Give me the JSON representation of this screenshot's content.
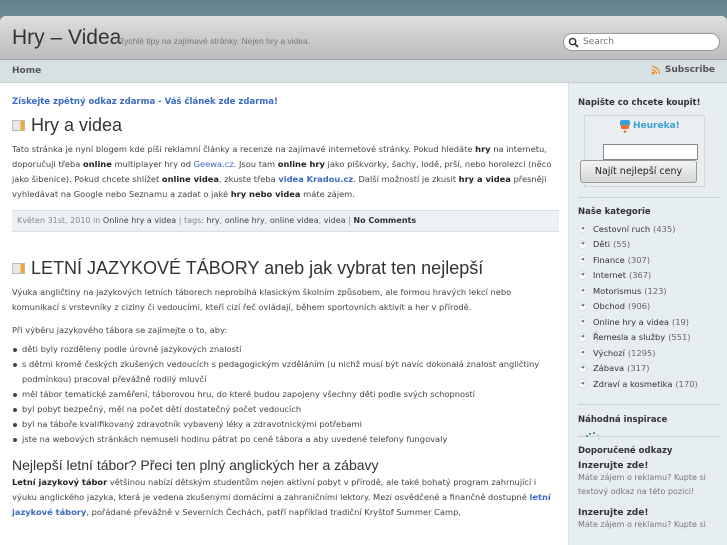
{
  "header": {
    "site_title": "Hry – Videa",
    "tagline": "Rychlé tipy na zajímavé stránky. Nejen hry a videa.",
    "search_placeholder": "Search"
  },
  "nav": {
    "home": "Home",
    "subscribe": "Subscribe"
  },
  "promo_link": "Získejte zpětný odkaz zdarma - Váš článek zde zdarma!",
  "post1": {
    "title": "Hry a videa",
    "p1": "Tato stránka je nyní blogem kde píši reklamní články a recenze na zajímavé internetové stránky. Pokud hledáte ",
    "b_hry": "hry",
    "p2": " na internetu, doporučuji třeba ",
    "b_online": "online",
    "p3": " multiplayer hry od ",
    "link_geewa": "Geewa.cz",
    "p4": ". Jsou tam ",
    "b_online_hry": "online hry",
    "p5": " jako piškvorky, šachy, lodě, prší, nebo horolezci (něco jako šibenice). Pokud chcete shlížet ",
    "b_online_videa": "online videa",
    "p6": ", zkuste třeba ",
    "link_kradou": "videa Kradou.cz",
    "p7": ". Další možností je zkusit ",
    "b_hry_a_videa": "hry a videa",
    "p8": " přesněji vyhledávat na Google nebo Seznamu a zadat o jaké ",
    "b_hry_nebo_videa": "hry nebo videa",
    "p9": " máte zájem.",
    "meta": {
      "date": "Květen 31st, 2010 in ",
      "category": "Online hry a videa",
      "tags_label": " | tags: ",
      "tags": [
        "hry",
        "online hry",
        "online videa",
        "videa"
      ],
      "comments": "No Comments"
    }
  },
  "post2": {
    "title": "LETNÍ JAZYKOVÉ TÁBORY aneb jak vybrat ten nejlepší",
    "intro": "Výuka angličtiny na jazykových letních táborech neprobíhá klasickým školním způsobem, ale formou hravých lekcí nebo komunikací s vrstevníky z ciziny či vedoucími, kteří cizí řeč ovládají, během sportovních aktivit a her v přírodě.",
    "lead": "Při výběru jazykového tábora se zajímejte o to, aby:",
    "bullets": [
      "děti byly rozděleny podle úrovně jazykových znalostí",
      "s dětmi kromě českých zkušených vedoucích s pedagogickým vzděláním (u nichž musí být navíc dokonalá znalost angličtiny podmínkou) pracoval převážně rodilý mluvčí",
      "měl tábor tematické zaměření, táborovou hru, do které budou zapojeny všechny děti podle svých schopností",
      "byl pobyt bezpečný, měl na počet dětí dostatečný počet vedoucích",
      "byl na táboře kvalifikovaný zdravotník vybavený léky a zdravotnickými potřebami",
      "jste na webových stránkách nemuseli hodinu pátrat po ceně tábora a aby uvedené telefony fungovaly"
    ],
    "subheading": "Nejlepší letní tábor? Přeci ten plný anglických her a zábavy",
    "s_b1": "Letní jazykový tábor",
    "s_t1": " většinou nabízí dětským studentům nejen aktivní pobyt v přírodě, ale také bohatý program zahrnující i výuku anglického jazyka, která je vedena zkušenými domácími a zahraničními lektory. Mezi osvědčené a finančně dostupné ",
    "s_link": "letní jazykové tábory",
    "s_t2": ", pořádané převážně v Severních Čechách, patří například tradiční Kryštof Summer Camp,"
  },
  "sidebar": {
    "buy_title": "Napište co chcete koupit!",
    "heureka_logo": "Heureka!",
    "heureka_button": "Najít nejlepší ceny",
    "categories_title": "Naše kategorie",
    "categories": [
      {
        "name": "Cestovní ruch",
        "count": "(435)"
      },
      {
        "name": "Děti",
        "count": "(55)"
      },
      {
        "name": "Finance",
        "count": "(307)"
      },
      {
        "name": "Internet",
        "count": "(367)"
      },
      {
        "name": "Motorismus",
        "count": "(123)"
      },
      {
        "name": "Obchod",
        "count": "(906)"
      },
      {
        "name": "Online hry a videa",
        "count": "(19)"
      },
      {
        "name": "Řemesla a služby",
        "count": "(551)"
      },
      {
        "name": "Výchozí",
        "count": "(1295)"
      },
      {
        "name": "Zábava",
        "count": "(317)"
      },
      {
        "name": "Zdraví a kosmetika",
        "count": "(170)"
      }
    ],
    "random_title": "Náhodná inspirace",
    "links_title": "Doporučené odkazy",
    "ads": [
      {
        "title": "Inzerujte zde!",
        "text": "Máte zájem o reklamu? Kupte si textový odkaz na této pozici!"
      },
      {
        "title": "Inzerujte zde!",
        "text": "Máte zájem o reklamu? Kupte si"
      }
    ]
  }
}
